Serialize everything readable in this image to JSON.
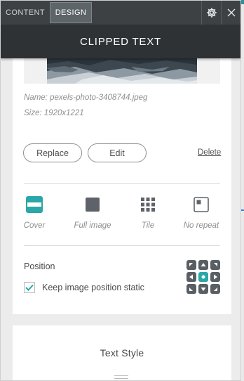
{
  "tabs": {
    "content": "CONTENT",
    "design": "DESIGN"
  },
  "header": {
    "title": "CLIPPED TEXT"
  },
  "image": {
    "name": "Name: pexels-photo-3408744.jpeg",
    "size": "Size: 1920x1221"
  },
  "actions": {
    "replace": "Replace",
    "edit": "Edit",
    "delete": "Delete"
  },
  "fill_options": {
    "cover": "Cover",
    "full": "Full image",
    "tile": "Tile",
    "no_repeat": "No repeat"
  },
  "position": {
    "label": "Position",
    "static_label": "Keep image position static",
    "static_checked": true,
    "selected": "center"
  },
  "text_style": {
    "label": "Text Style"
  },
  "colors": {
    "accent": "#2aa7a8",
    "topbar": "#3d4144",
    "titlebar": "#2e3235"
  }
}
